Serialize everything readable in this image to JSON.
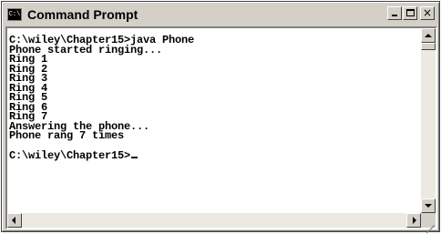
{
  "window": {
    "title": "Command Prompt",
    "icon_label": "C:\\"
  },
  "console": {
    "lines": [
      "C:\\wiley\\Chapter15>java Phone",
      "Phone started ringing...",
      "Ring 1",
      "Ring 2",
      "Ring 3",
      "Ring 4",
      "Ring 5",
      "Ring 6",
      "Ring 7",
      "Answering the phone...",
      "Phone rang 7 times",
      "",
      "C:\\wiley\\Chapter15>"
    ]
  },
  "icons": {
    "app": "console-icon",
    "minimize": "minimize-icon",
    "maximize": "maximize-icon",
    "close": "close-icon",
    "scroll_up": "arrow-up-icon",
    "scroll_down": "arrow-down-icon",
    "scroll_left": "arrow-left-icon",
    "scroll_right": "arrow-right-icon",
    "resize": "size-grip-icon"
  },
  "colors": {
    "chrome": "#d4d0c8",
    "console_bg": "#ffffff",
    "console_text": "#000000"
  },
  "close_glyph": "×"
}
